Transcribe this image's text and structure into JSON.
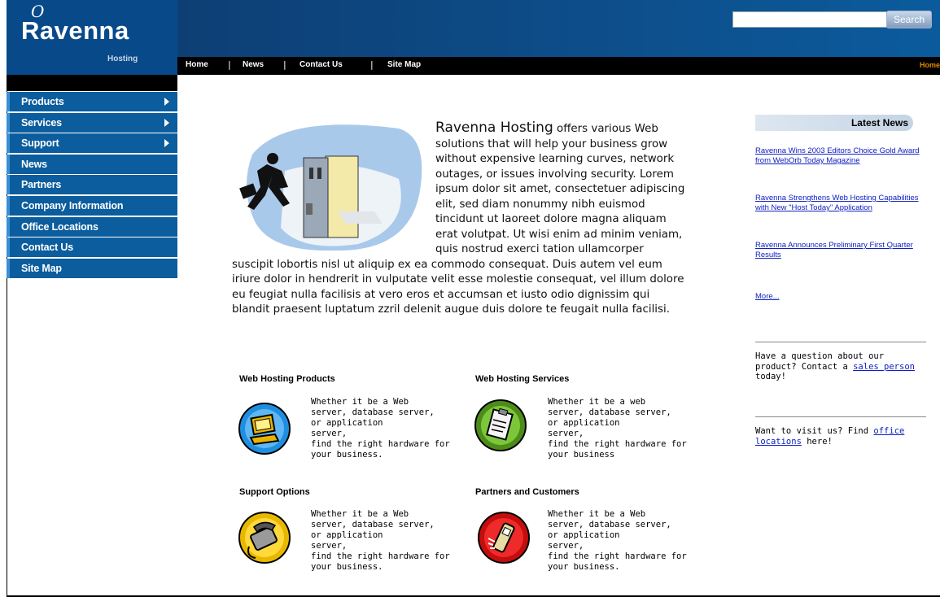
{
  "brand": {
    "logo_mark": "O",
    "name": "Ravenna",
    "sub": "Hosting"
  },
  "search": {
    "placeholder": "",
    "button_label": "Search"
  },
  "nav": {
    "items": [
      "Home",
      "News",
      "Contact Us",
      "Site Map"
    ],
    "separator": "|",
    "right_link": "Home"
  },
  "menu": {
    "items": [
      {
        "label": "Products",
        "has_submenu": true
      },
      {
        "label": "Services",
        "has_submenu": true
      },
      {
        "label": "Support",
        "has_submenu": true
      },
      {
        "label": "News",
        "has_submenu": false
      },
      {
        "label": "Partners",
        "has_submenu": false
      },
      {
        "label": "Company Information",
        "has_submenu": false
      },
      {
        "label": "Office Locations",
        "has_submenu": false
      },
      {
        "label": "Contact Us",
        "has_submenu": false
      },
      {
        "label": "Site Map",
        "has_submenu": false
      }
    ]
  },
  "intro": {
    "lead": "Ravenna Hosting",
    "body": " offers various Web solutions that will help your business grow without expensive learning curves, network outages, or issues involving security. Lorem ipsum dolor sit amet, consectetuer adipiscing elit, sed diam nonummy nibh euismod tincidunt ut laoreet dolore magna aliquam erat volutpat. Ut wisi enim ad minim veniam, quis nostrud exerci tation ullamcorper suscipit lobortis nisl ut aliquip ex ea commodo consequat. Duis autem vel eum iriure dolor in hendrerit in vulputate velit esse molestie consequat, vel illum dolore eu feugiat nulla facilisis at vero eros et accumsan et iusto odio dignissim qui blandit praesent luptatum zzril delenit augue duis dolore te feugait nulla facilisi."
  },
  "features": [
    {
      "title": "Web Hosting Products",
      "icon": "computer-icon",
      "text": "Whether it be a Web\nserver, database server,\nor application\nserver,\nfind the right hardware for\nyour business."
    },
    {
      "title": "Web Hosting Services",
      "icon": "clipboard-icon",
      "text": "Whether it be a web\nserver, database server,\nor application\nserver,\nfind the right hardware for\nyour business"
    },
    {
      "title": "Support Options",
      "icon": "telephone-icon",
      "text": "Whether it be a Web\nserver, database server,\nor application\nserver,\nfind the right hardware for\nyour business."
    },
    {
      "title": "Partners and Customers",
      "icon": "mobile-phone-icon",
      "text": "Whether it be a Web\nserver, database server,\nor application\nserver,\nfind the right hardware for\nyour business."
    }
  ],
  "news": {
    "title": "Latest News",
    "items": [
      "Ravenna Wins 2003 Editors Choice Gold Award from WebOrb Today Magazine",
      "Ravenna Strengthens Web Hosting Capabilities with New \"Host Today\" Application",
      "Ravenna Announces Preliminary First Quarter Results"
    ],
    "more": "More..."
  },
  "sidebar": {
    "question_pre": "Have a question about our product? Contact a ",
    "question_link": "sales person",
    "question_post": " today!",
    "visit_pre": "Want to visit us? Find ",
    "visit_link": "office locations",
    "visit_post": " here!"
  },
  "colors": {
    "header_blue": "#0d4f8c",
    "menu_blue": "#0b5d9d",
    "link_blue": "#1020c0"
  }
}
